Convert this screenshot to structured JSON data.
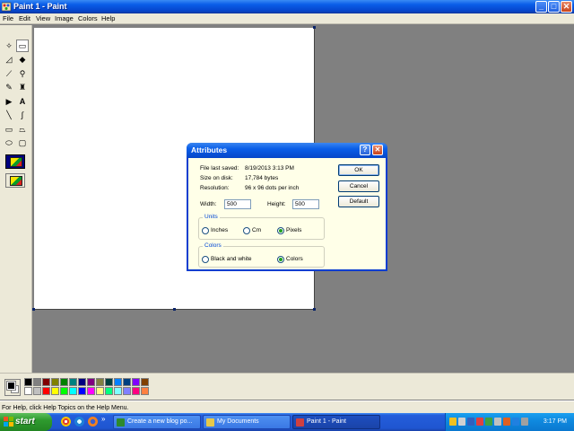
{
  "window": {
    "title": "Paint 1 - Paint",
    "minimize": "_",
    "maximize": "□",
    "close": "✕"
  },
  "menu": [
    "File",
    "Edit",
    "View",
    "Image",
    "Colors",
    "Help"
  ],
  "tools": [
    {
      "name": "free-form-select",
      "glyph": "✧"
    },
    {
      "name": "rect-select",
      "glyph": "▭"
    },
    {
      "name": "eraser",
      "glyph": "◿"
    },
    {
      "name": "fill",
      "glyph": "◆"
    },
    {
      "name": "pick-color",
      "glyph": "⟋"
    },
    {
      "name": "magnifier",
      "glyph": "⚲"
    },
    {
      "name": "pencil",
      "glyph": "✎"
    },
    {
      "name": "brush",
      "glyph": "♜"
    },
    {
      "name": "airbrush",
      "glyph": "▶"
    },
    {
      "name": "text",
      "glyph": "A"
    },
    {
      "name": "line",
      "glyph": "╲"
    },
    {
      "name": "curve",
      "glyph": "∫"
    },
    {
      "name": "rectangle",
      "glyph": "▭"
    },
    {
      "name": "polygon",
      "glyph": "⏢"
    },
    {
      "name": "ellipse",
      "glyph": "⬭"
    },
    {
      "name": "rounded-rect",
      "glyph": "▢"
    }
  ],
  "palette": {
    "top": [
      "#000000",
      "#808080",
      "#800000",
      "#808000",
      "#008000",
      "#008080",
      "#000080",
      "#800080",
      "#808040",
      "#004040",
      "#0080ff",
      "#004080",
      "#8000ff",
      "#804000"
    ],
    "bottom": [
      "#ffffff",
      "#c0c0c0",
      "#ff0000",
      "#ffff00",
      "#00ff00",
      "#00ffff",
      "#0000ff",
      "#ff00ff",
      "#ffff80",
      "#00ff80",
      "#80ffff",
      "#8080ff",
      "#ff0080",
      "#ff8040"
    ]
  },
  "status": "For Help, click Help Topics on the Help Menu.",
  "dialog": {
    "title": "Attributes",
    "help": "?",
    "close": "✕",
    "file_last_saved_label": "File last saved:",
    "file_last_saved": "8/19/2013 3:13 PM",
    "size_on_disk_label": "Size on disk:",
    "size_on_disk": "17,784 bytes",
    "resolution_label": "Resolution:",
    "resolution": "96 x 96 dots per inch",
    "width_label": "Width:",
    "width": "500",
    "height_label": "Height:",
    "height": "500",
    "units_label": "Units",
    "units": {
      "inches": "Inches",
      "cm": "Cm",
      "pixels": "Pixels",
      "selected": "pixels"
    },
    "colors_label": "Colors",
    "colors": {
      "bw": "Black and white",
      "colors": "Colors",
      "selected": "colors"
    },
    "ok": "OK",
    "cancel": "Cancel",
    "default": "Default"
  },
  "taskbar": {
    "start": "start",
    "tasks": [
      {
        "label": "Create a new blog po...",
        "icon_color": "#2d8a2d"
      },
      {
        "label": "My Documents",
        "icon_color": "#e7c94a"
      },
      {
        "label": "Paint 1 - Paint",
        "icon_color": "#d04040"
      }
    ],
    "overflow": "»",
    "clock": "3:17 PM"
  }
}
